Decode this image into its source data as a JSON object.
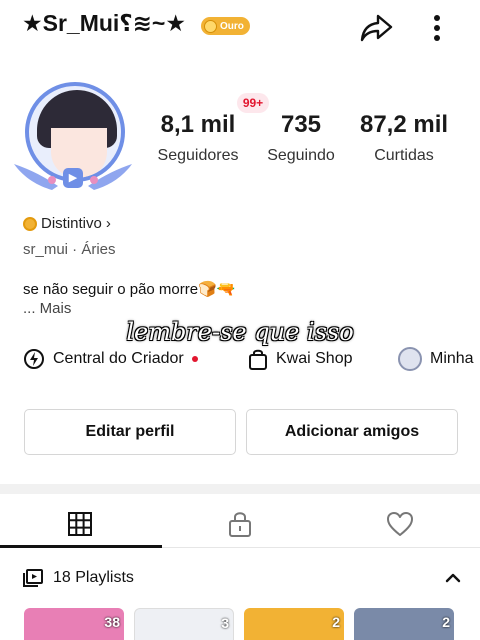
{
  "header": {
    "username": "★Sr_Mui⸮≋~★",
    "badge_label": "Ouro"
  },
  "profile": {
    "notification_badge": "99+",
    "stats": [
      {
        "value": "8,1 mil",
        "label": "Seguidores"
      },
      {
        "value": "735",
        "label": "Seguindo"
      },
      {
        "value": "87,2 mil",
        "label": "Curtidas"
      }
    ],
    "distintivo": "Distintivo",
    "distintivo_chevron": "›",
    "handle": "sr_mui · Áries",
    "bio": "se não seguir o pão morre🍞🔫",
    "bio_more": "...  Mais"
  },
  "video_overlay_caption": "lembre-se que isso",
  "quick_links": [
    {
      "label": "Central do Criador"
    },
    {
      "label": "Kwai Shop"
    },
    {
      "label": "Minha"
    }
  ],
  "actions": {
    "edit_profile": "Editar perfil",
    "add_friends": "Adicionar amigos"
  },
  "tabs": [
    "grid-icon",
    "lock-icon",
    "heart-icon"
  ],
  "playlists": {
    "label": "18 Playlists",
    "thumbnails": [
      {
        "count": "38",
        "color": "#e87fb5"
      },
      {
        "count": "3",
        "color": "#eef0f4"
      },
      {
        "count": "2",
        "color": "#f2b234"
      },
      {
        "count": "2",
        "color": "#7a8aa8"
      }
    ]
  },
  "colors": {
    "gold": "#f2b234",
    "red": "#e2162f",
    "avatar_ring": "#6f8fe6"
  }
}
